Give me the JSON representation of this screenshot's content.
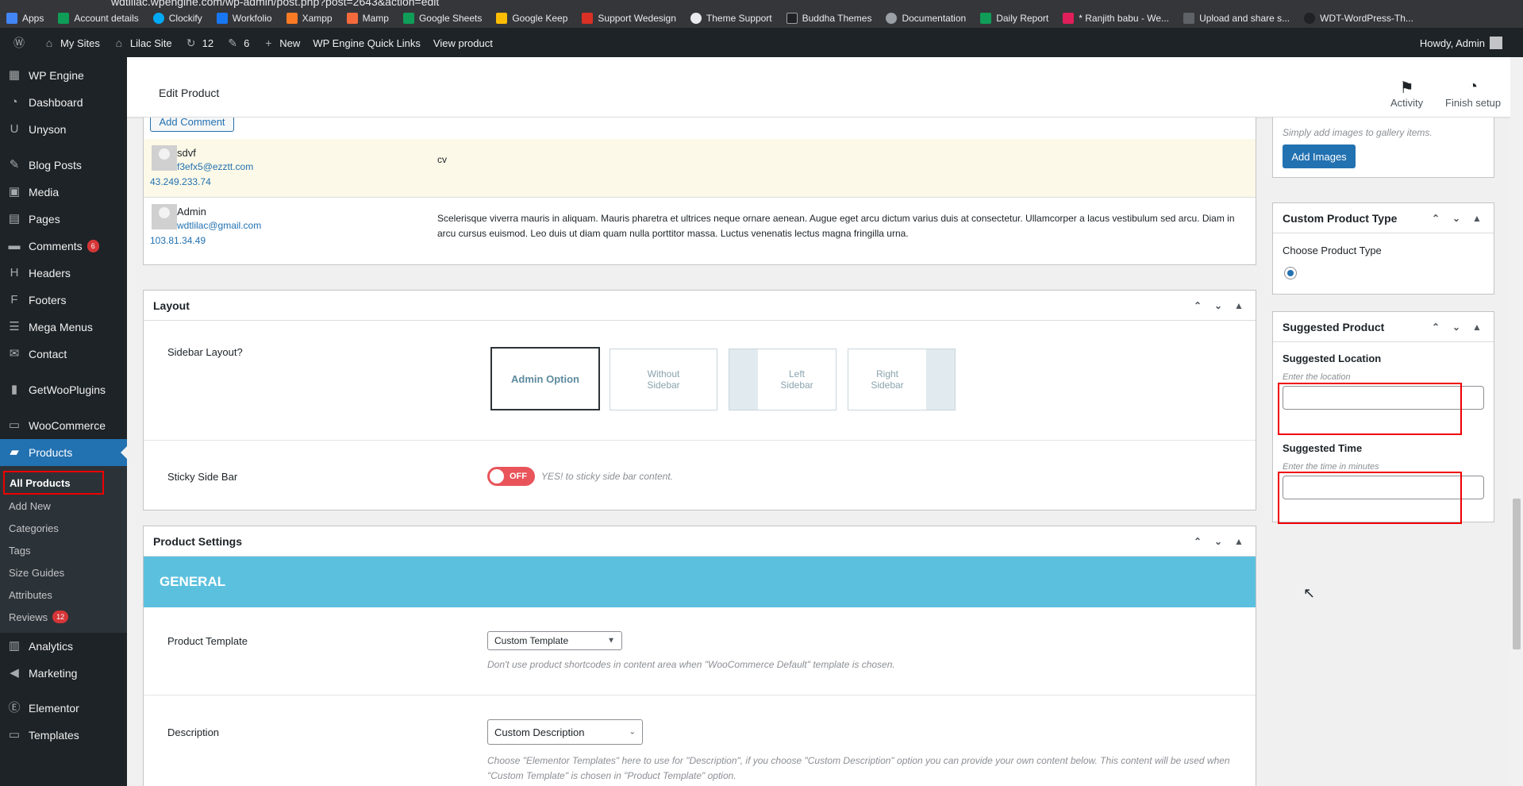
{
  "browser": {
    "url": "wdtlilac.wpengine.com/wp-admin/post.php?post=2643&action=edit",
    "bookmarks": [
      "Apps",
      "Account details",
      "Clockify",
      "Workfolio",
      "Xampp",
      "Mamp",
      "Google Sheets",
      "Google Keep",
      "Support Wedesign",
      "Theme Support",
      "Buddha Themes",
      "Documentation",
      "Daily Report",
      "* Ranjith babu - We...",
      "Upload and share s...",
      "WDT-WordPress-Th..."
    ]
  },
  "adminbar": {
    "my_sites": "My Sites",
    "site": "Lilac Site",
    "updates": "12",
    "comments": "6",
    "new": "New",
    "quick_links": "WP Engine Quick Links",
    "view_product": "View product",
    "howdy": "Howdy, Admin"
  },
  "sidebar": {
    "items": [
      {
        "label": "WP Engine",
        "icon": "wpengine-icon"
      },
      {
        "label": "Dashboard",
        "icon": "dashboard-icon"
      },
      {
        "label": "Unyson",
        "icon": "unyson-icon"
      },
      {
        "label": "Blog Posts",
        "icon": "pin-icon"
      },
      {
        "label": "Media",
        "icon": "media-icon"
      },
      {
        "label": "Pages",
        "icon": "pages-icon"
      },
      {
        "label": "Comments",
        "icon": "comments-icon",
        "badge": "6"
      },
      {
        "label": "Headers",
        "icon": "headers-icon"
      },
      {
        "label": "Footers",
        "icon": "footers-icon"
      },
      {
        "label": "Mega Menus",
        "icon": "mega-menus-icon"
      },
      {
        "label": "Contact",
        "icon": "mail-icon"
      },
      {
        "label": "GetWooPlugins",
        "icon": "plugins-icon"
      },
      {
        "label": "WooCommerce",
        "icon": "woo-icon"
      },
      {
        "label": "Products",
        "icon": "archive-icon"
      }
    ],
    "submenu": [
      "All Products",
      "Add New",
      "Categories",
      "Tags",
      "Size Guides",
      "Attributes",
      "Reviews"
    ],
    "reviews_badge": "12",
    "after": [
      {
        "label": "Analytics",
        "icon": "analytics-icon"
      },
      {
        "label": "Marketing",
        "icon": "megaphone-icon"
      },
      {
        "label": "Elementor",
        "icon": "elementor-icon"
      },
      {
        "label": "Templates",
        "icon": "folder-icon"
      }
    ]
  },
  "topbar": {
    "title": "Edit Product",
    "activity": "Activity",
    "finish_setup": "Finish setup"
  },
  "comments": {
    "add_comment": "Add Comment",
    "rows": [
      {
        "author": "sdvf",
        "email": "f3efx5@ezztt.com",
        "ip": "43.249.233.74",
        "text": "cv"
      },
      {
        "author": "Admin",
        "email": "wdtlilac@gmail.com",
        "ip": "103.81.34.49",
        "text": "Scelerisque viverra mauris in aliquam. Mauris pharetra et ultrices neque ornare aenean. Augue eget arcu dictum varius duis at consectetur. Ullamcorper a lacus vestibulum sed arcu. Diam in arcu cursus euismod. Leo duis ut diam quam nulla porttitor massa. Luctus venenatis lectus magna fringilla urna."
      }
    ]
  },
  "layout": {
    "title": "Layout",
    "sidebar_label": "Sidebar Layout?",
    "options": [
      "Admin Option",
      "Without Sidebar",
      "Left Sidebar",
      "Right Sidebar"
    ],
    "sticky_label": "Sticky Side Bar",
    "sticky_state": "OFF",
    "sticky_hint": "YES! to sticky side bar content."
  },
  "product_settings": {
    "title": "Product Settings",
    "tab": "GENERAL",
    "template_label": "Product Template",
    "template_value": "Custom Template",
    "template_hint": "Don't use product shortcodes in content area when \"WooCommerce Default\" template is chosen.",
    "description_label": "Description",
    "description_value": "Custom Description",
    "description_hint": "Choose \"Elementor Templates\" here to use for \"Description\", if you choose \"Custom Description\" option you can provide your own content below. This content will be used when \"Custom Template\" is chosen in \"Product Template\" option."
  },
  "right": {
    "gallery_hint": "Simply add images to gallery items.",
    "add_images": "Add Images",
    "custom_type_title": "Custom Product Type",
    "choose_type": "Choose Product Type",
    "suggested_title": "Suggested Product",
    "location_label": "Suggested Location",
    "location_placeholder": "Enter the location",
    "time_label": "Suggested Time",
    "time_placeholder": "Enter the time in minutes"
  }
}
